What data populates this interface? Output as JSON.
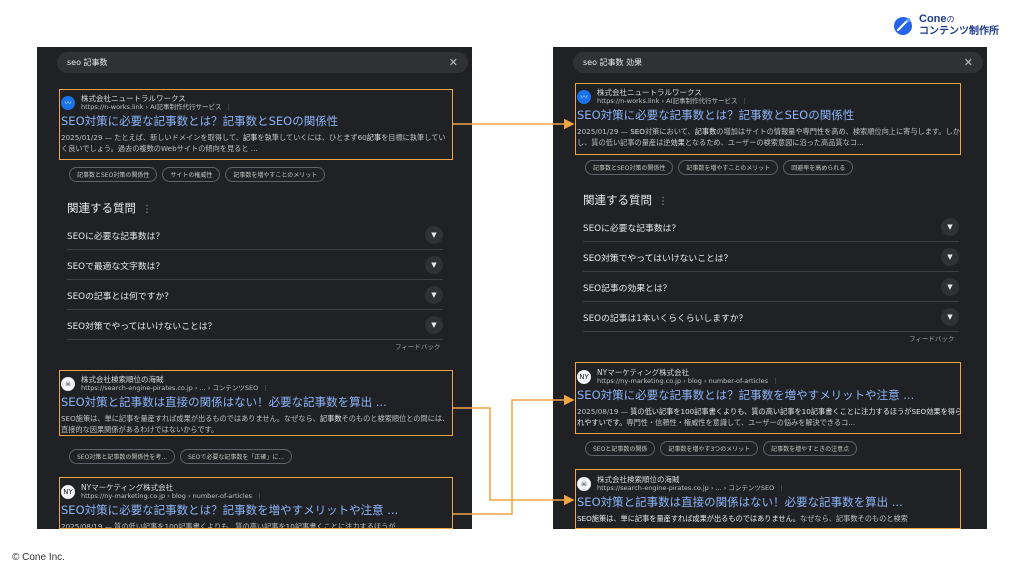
{
  "brand": {
    "name": "Cone",
    "suffix": "の",
    "line2": "コンテンツ制作所",
    "color": "#1e3a8a"
  },
  "copyright": "© Cone Inc.",
  "colors": {
    "highlight": "#f0a442",
    "link": "#8ab4f8",
    "background": "#202124"
  },
  "left": {
    "query": "seo 記事数",
    "results": [
      {
        "favicon": "pulse-icon",
        "site": "株式会社ニュートラルワークス",
        "url": "https://n-works.link › AI記事制作代行サービス",
        "title": "SEO対策に必要な記事数とは？記事数とSEOの関係性",
        "snippet_html": "2025/01/29 — たとえば、新しいドメインを取得して、<b>記事</b>を執筆していくには、ひとまず60<b>記事</b>を目標に執筆していく良いでしょう。過去の複数のWebサイトの傾向を見ると ...",
        "chips": [
          "記事数とSEO対策の関係性",
          "サイトの権威性",
          "記事数を増やすことのメリット"
        ]
      },
      {
        "favicon": "pirate-icon",
        "site": "株式会社検索順位の海賊",
        "url": "https://search-engine-pirates.co.jp › ... › コンテンツSEO",
        "title": "SEO対策と記事数は直接の関係はない！必要な記事数を算出 ...",
        "snippet_html": "SEO施策は、単に記事を量産すれば成果が出るものではありません。なぜなら、<b>記事数</b>そのものと検索順位との間には、直接的な因果関係があるわけではないからです。",
        "chips": [
          "SEO対策と記事数の関係性を考...",
          "SEOで必要な記事数を「正確」に..."
        ]
      },
      {
        "favicon": "ny-icon",
        "site": "NYマーケティング株式会社",
        "url": "https://ny-marketing.co.jp › blog › number-of-articles",
        "title": "SEO対策に必要な記事数とは？記事数を増やすメリットや注意 ...",
        "snippet_html": "2025/08/19 — 質の低い記事を100記事書くよりも、質の高い記事を10記事書くことに注力するほうが",
        "chips": []
      }
    ],
    "paa_title": "関連する質問",
    "paa": [
      "SEOに必要な記事数は？",
      "SEOで最適な文字数は？",
      "SEOの記事とは何ですか？",
      "SEO対策でやってはいけないことは？"
    ],
    "feedback": "フィードバック"
  },
  "right": {
    "query": "seo 記事数 効果",
    "results": [
      {
        "favicon": "pulse-icon",
        "site": "株式会社ニュートラルワークス",
        "url": "https://n-works.link › AI記事制作代行サービス",
        "title": "SEO対策に必要な記事数とは？記事数とSEOの関係性",
        "snippet_html": "2025/01/29 — <b>SEO</b>対策において、<b>記事数</b>の増加はサイトの情報量や専門性を高め、検索順位向上に寄与します。しかし、質の低い記事の量産は逆<b>効果</b>となるため、ユーザーの検索意図に沿った高品質なコ...",
        "chips": [
          "記事数とSEO対策の関係性",
          "記事数を増やすことのメリット",
          "回避率を高められる"
        ]
      },
      {
        "favicon": "ny-icon",
        "site": "NYマーケティング株式会社",
        "url": "https://ny-marketing.co.jp › blog › number-of-articles",
        "title": "SEO対策に必要な記事数とは？記事数を増やすメリットや注意 ...",
        "snippet_html": "2025/08/19 — <b>質の低い記事を100記事書くよりも、質の高い記事を10記事書くことに注力するほうがSEO効果を得られやすいです。</b>専門性・信頼性・権威性を意識して、ユーザーの悩みを解決できるコ...",
        "chips": [
          "SEOと記事数の関係",
          "記事数を増やす3つのメリット",
          "記事数を増やすときの注意点"
        ]
      },
      {
        "favicon": "pirate-icon",
        "site": "株式会社検索順位の海賊",
        "url": "https://search-engine-pirates.co.jp › ... › コンテンツSEO",
        "title": "SEO対策と記事数は直接の関係はない！必要な記事数を算出 ...",
        "snippet_html": "<b>SEO施策は、単に記事を量産すれば成果が出るものではありません。</b>なぜなら、記事数そのものと検索",
        "chips": []
      }
    ],
    "paa_title": "関連する質問",
    "paa": [
      "SEOに必要な記事数は？",
      "SEO対策でやってはいけないことは？",
      "SEO記事の効果とは？",
      "SEOの記事は1本いくらくらいしますか？"
    ],
    "feedback": "フィードバック"
  }
}
